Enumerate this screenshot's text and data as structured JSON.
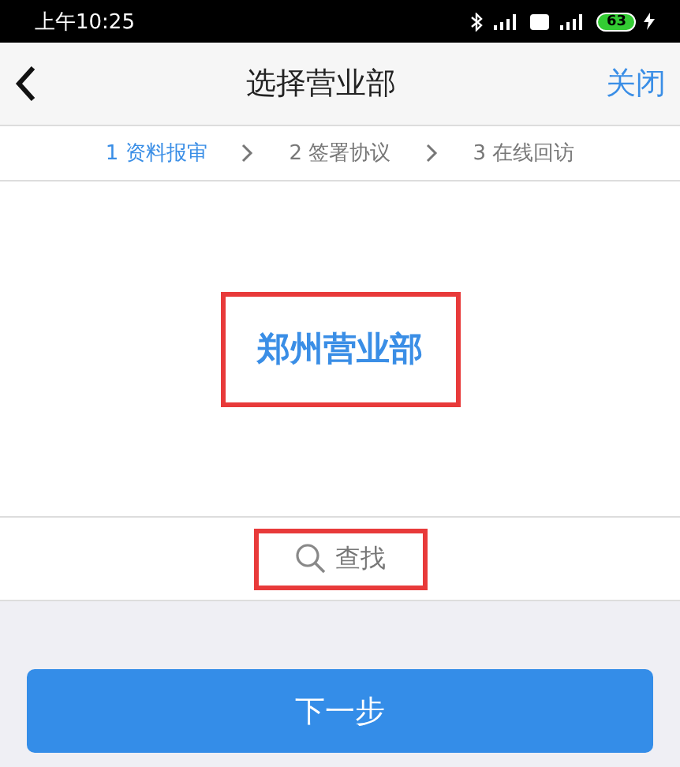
{
  "status_bar": {
    "time": "上午10:25",
    "battery": "63"
  },
  "nav": {
    "title": "选择营业部",
    "close": "关闭"
  },
  "steps": [
    {
      "label": "1 资料报审",
      "selected": true
    },
    {
      "label": "2 签署协议",
      "selected": false
    },
    {
      "label": "3 在线回访",
      "selected": false
    }
  ],
  "branch": {
    "name": "郑州营业部"
  },
  "search": {
    "label": "查找"
  },
  "buttons": [
    "下一步"
  ]
}
